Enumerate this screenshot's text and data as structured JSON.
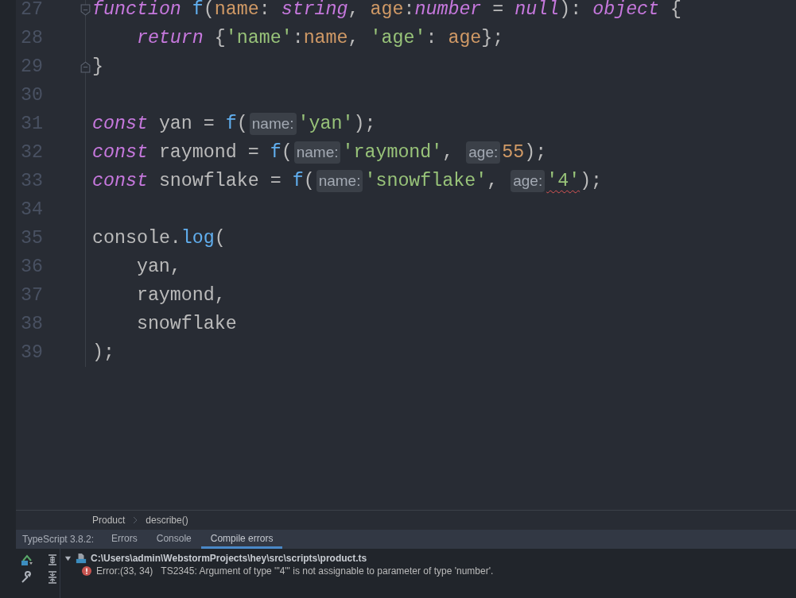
{
  "editor": {
    "lines": [
      {
        "number": "27",
        "fold_open": true,
        "tokens": [
          {
            "kind": "keyword",
            "text": "function",
            "space_after": true
          },
          {
            "kind": "function",
            "text": "f"
          },
          {
            "kind": "plain",
            "text": "("
          },
          {
            "kind": "param",
            "text": "name"
          },
          {
            "kind": "plain",
            "text": ": "
          },
          {
            "kind": "keyword",
            "text": "string"
          },
          {
            "kind": "plain",
            "text": ", "
          },
          {
            "kind": "param",
            "text": "age"
          },
          {
            "kind": "plain",
            "text": ":"
          },
          {
            "kind": "keyword",
            "text": "number"
          },
          {
            "kind": "plain",
            "text": " = "
          },
          {
            "kind": "keyword",
            "text": "null"
          },
          {
            "kind": "plain",
            "text": "): "
          },
          {
            "kind": "keyword",
            "text": "object"
          },
          {
            "kind": "plain",
            "text": " {"
          }
        ]
      },
      {
        "number": "28",
        "indented": true,
        "tokens": [
          {
            "kind": "keyword",
            "text": "return"
          },
          {
            "kind": "plain",
            "text": " {"
          },
          {
            "kind": "string",
            "text": "'name'"
          },
          {
            "kind": "plain",
            "text": ":"
          },
          {
            "kind": "param",
            "text": "name"
          },
          {
            "kind": "plain",
            "text": ", "
          },
          {
            "kind": "string",
            "text": "'age'"
          },
          {
            "kind": "plain",
            "text": ": "
          },
          {
            "kind": "param",
            "text": "age"
          },
          {
            "kind": "plain",
            "text": "};"
          }
        ]
      },
      {
        "number": "29",
        "fold_close": true,
        "tokens": [
          {
            "kind": "plain",
            "text": "}"
          }
        ]
      },
      {
        "number": "30"
      },
      {
        "number": "31",
        "tokens": [
          {
            "kind": "keyword",
            "text": "const"
          },
          {
            "kind": "plain",
            "text": " yan = "
          },
          {
            "kind": "function",
            "text": "f"
          },
          {
            "kind": "plain",
            "text": "("
          },
          {
            "kind": "hint",
            "text": "name:"
          },
          {
            "kind": "string",
            "text": "'yan'"
          },
          {
            "kind": "plain",
            "text": ");"
          }
        ]
      },
      {
        "number": "32",
        "tokens": [
          {
            "kind": "keyword",
            "text": "const"
          },
          {
            "kind": "plain",
            "text": " raymond = "
          },
          {
            "kind": "function",
            "text": "f"
          },
          {
            "kind": "plain",
            "text": "("
          },
          {
            "kind": "hint",
            "text": "name:"
          },
          {
            "kind": "string",
            "text": "'raymond'"
          },
          {
            "kind": "plain",
            "text": ", "
          },
          {
            "kind": "hint",
            "text": "age:"
          },
          {
            "kind": "number",
            "text": "55"
          },
          {
            "kind": "plain",
            "text": ");"
          }
        ]
      },
      {
        "number": "33",
        "tokens": [
          {
            "kind": "keyword",
            "text": "const"
          },
          {
            "kind": "plain",
            "text": " snowflake = "
          },
          {
            "kind": "function",
            "text": "f"
          },
          {
            "kind": "plain",
            "text": "("
          },
          {
            "kind": "hint",
            "text": "name:"
          },
          {
            "kind": "string",
            "text": "'snowflake'"
          },
          {
            "kind": "plain",
            "text": ", "
          },
          {
            "kind": "hint",
            "text": "age:"
          },
          {
            "kind": "string",
            "text": "'4'",
            "error": true
          },
          {
            "kind": "plain",
            "text": ");"
          }
        ]
      },
      {
        "number": "34"
      },
      {
        "number": "35",
        "tokens": [
          {
            "kind": "plain",
            "text": "console."
          },
          {
            "kind": "function",
            "text": "log"
          },
          {
            "kind": "plain",
            "text": "("
          }
        ]
      },
      {
        "number": "36",
        "indented": true,
        "tokens": [
          {
            "kind": "plain",
            "text": "yan,"
          }
        ]
      },
      {
        "number": "37",
        "indented": true,
        "tokens": [
          {
            "kind": "plain",
            "text": "raymond,"
          }
        ]
      },
      {
        "number": "38",
        "indented": true,
        "tokens": [
          {
            "kind": "plain",
            "text": "snowflake"
          }
        ]
      },
      {
        "number": "39",
        "tokens": [
          {
            "kind": "plain",
            "text": ");"
          }
        ]
      }
    ]
  },
  "breadcrumb": [
    "Product",
    "describe()"
  ],
  "problems": {
    "label": "TypeScript 3.8.2:",
    "tabs": [
      {
        "label": "Errors",
        "selected": false
      },
      {
        "label": "Console",
        "selected": false
      },
      {
        "label": "Compile errors",
        "selected": true
      }
    ],
    "tree": [
      {
        "label": "C:\\Users\\admin\\WebstormProjects\\hey\\src\\scripts\\product.ts",
        "expanded": true,
        "children": [
          {
            "location": "Error:(33, 34)",
            "message": "TS2345: Argument of type '\"4\"' is not assignable to parameter of type 'number'."
          }
        ]
      }
    ]
  }
}
